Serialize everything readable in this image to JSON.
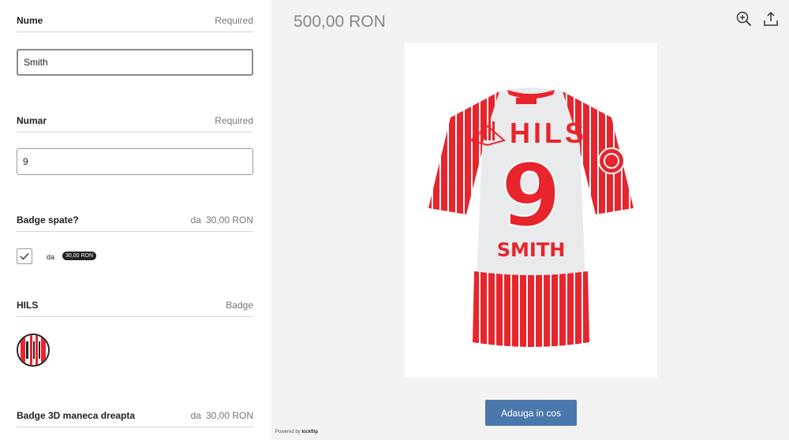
{
  "form": {
    "nume": {
      "title": "Nume",
      "note": "Required",
      "value": "Smith"
    },
    "numar": {
      "title": "Numar",
      "note": "Required",
      "value": "9"
    },
    "badge_spate": {
      "title": "Badge spate?",
      "note_label": "da",
      "note_price": "30,00 RON",
      "option_label": "da",
      "option_price": "30,00 RON",
      "checked": true
    },
    "hils": {
      "title": "HILS",
      "note": "Badge"
    },
    "badge_maneca": {
      "title": "Badge 3D maneca dreapta",
      "note_label": "da",
      "note_price": "30,00 RON"
    }
  },
  "preview": {
    "price": "500,00 RON",
    "shirt_sponsor": "HILS",
    "shirt_number": "9",
    "shirt_name": "SMITH",
    "colors": {
      "red": "#e8242c",
      "white": "#e8eaec"
    }
  },
  "actions": {
    "add_to_cart": "Adauga in cos"
  },
  "footer": {
    "powered_by": "Powered by",
    "brand": "kickflip"
  },
  "icons": {
    "zoom": "zoom-in-icon",
    "share": "share-upload-icon",
    "check": "checkmark-icon"
  },
  "accent_color": "#4a78ad"
}
